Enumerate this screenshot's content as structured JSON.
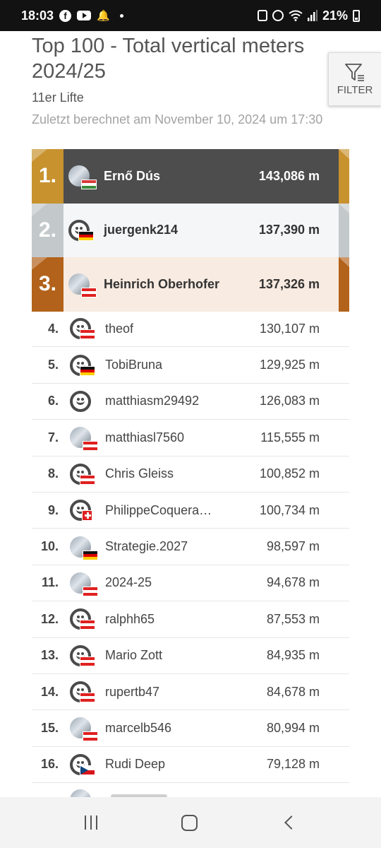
{
  "status_bar": {
    "time": "18:03",
    "battery": "21%",
    "icons": [
      "facebook-icon",
      "youtube-icon",
      "bell-icon",
      "wifi-icon",
      "signal-icon",
      "alarm-icon",
      "battery-icon"
    ]
  },
  "header": {
    "title": "Top 100 - Total vertical meters 2024/25",
    "subtitle": "11er Lifte",
    "computed": "Zuletzt berechnet am November 10, 2024 um 17:30",
    "filter_label": "FILTER"
  },
  "podium": [
    {
      "rank": "1.",
      "name": "Ernő Dús",
      "meters": "143,086 m",
      "avatar": "photo",
      "flag": "hu"
    },
    {
      "rank": "2.",
      "name": "juergenk214",
      "meters": "137,390 m",
      "avatar": "smiley",
      "flag": "de"
    },
    {
      "rank": "3.",
      "name": "Heinrich Oberhofer",
      "meters": "137,326 m",
      "avatar": "photo",
      "flag": "at"
    }
  ],
  "rows": [
    {
      "rank": "4.",
      "name": "theof",
      "meters": "130,107 m",
      "avatar": "smiley",
      "flag": "at"
    },
    {
      "rank": "5.",
      "name": "TobiBruna",
      "meters": "129,925 m",
      "avatar": "smiley",
      "flag": "de"
    },
    {
      "rank": "6.",
      "name": "matthiasm29492",
      "meters": "126,083 m",
      "avatar": "smiley",
      "flag": ""
    },
    {
      "rank": "7.",
      "name": "matthiasl7560",
      "meters": "115,555 m",
      "avatar": "photo",
      "flag": "at"
    },
    {
      "rank": "8.",
      "name": "Chris Gleiss",
      "meters": "100,852 m",
      "avatar": "smiley",
      "flag": "at"
    },
    {
      "rank": "9.",
      "name": "PhilippeCoquera…",
      "meters": "100,734 m",
      "avatar": "smiley",
      "flag": "ch"
    },
    {
      "rank": "10.",
      "name": "Strategie.2027",
      "meters": "98,597 m",
      "avatar": "photo",
      "flag": "de"
    },
    {
      "rank": "11.",
      "name": "2024-25",
      "meters": "94,678 m",
      "avatar": "photo",
      "flag": "at"
    },
    {
      "rank": "12.",
      "name": "ralphh65",
      "meters": "87,553 m",
      "avatar": "smiley",
      "flag": "at"
    },
    {
      "rank": "13.",
      "name": "Mario Zott",
      "meters": "84,935 m",
      "avatar": "smiley",
      "flag": "at"
    },
    {
      "rank": "14.",
      "name": "rupertb47",
      "meters": "84,678 m",
      "avatar": "smiley",
      "flag": "at"
    },
    {
      "rank": "15.",
      "name": "marcelb546",
      "meters": "80,994 m",
      "avatar": "photo",
      "flag": "at"
    },
    {
      "rank": "16.",
      "name": "Rudi Deep",
      "meters": "79,128 m",
      "avatar": "smiley",
      "flag": "cz"
    }
  ],
  "colors": {
    "gold": "#c8922f",
    "silver": "#c3c9cb",
    "bronze": "#b2621a",
    "first_row_bg": "#4d4d4d"
  }
}
